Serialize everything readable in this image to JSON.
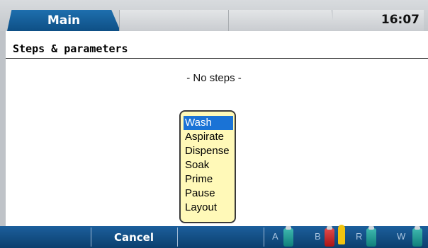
{
  "tabs": [
    {
      "label": "Main",
      "active": true
    },
    {
      "label": "",
      "active": false
    },
    {
      "label": "",
      "active": false
    },
    {
      "label": "",
      "active": false
    }
  ],
  "clock": "16:07",
  "section": {
    "title": "Steps & parameters"
  },
  "empty_message": "- No steps -",
  "step_menu": {
    "items": [
      "Wash",
      "Aspirate",
      "Dispense",
      "Soak",
      "Prime",
      "Pause",
      "Layout"
    ],
    "selected": "Wash"
  },
  "bottom_bar": {
    "cancel_label": "Cancel",
    "bottles": [
      {
        "label": "A",
        "color": "#2aa7a0"
      },
      {
        "label": "B",
        "color": "#d02a2a",
        "warning": true
      },
      {
        "label": "R",
        "color": "#2aa7a0"
      },
      {
        "label": "W",
        "color": "#2aa7a0"
      }
    ]
  },
  "colors": {
    "accent": "#0e4f85",
    "popup_bg": "#fff9b8",
    "selection": "#1a73d6"
  }
}
